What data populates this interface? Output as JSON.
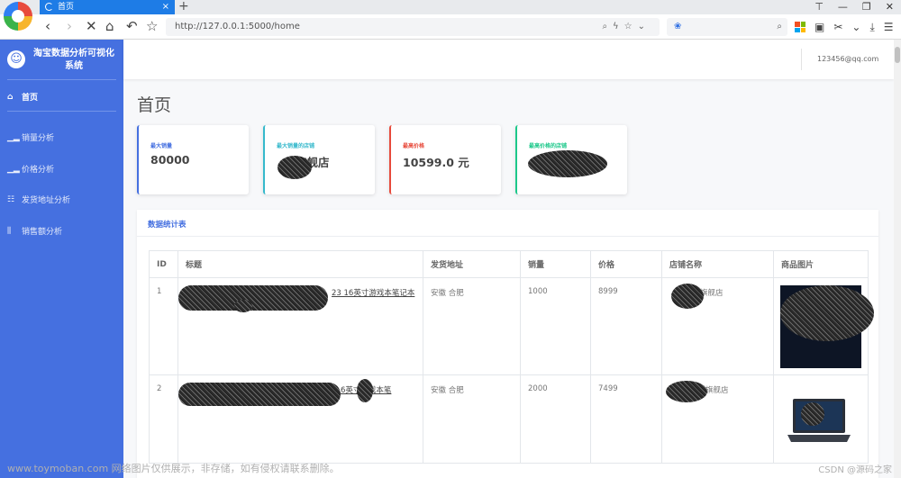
{
  "browser": {
    "tab_title": "首页",
    "tab_close": "×",
    "new_tab": "+",
    "url": "http://127.0.0.1:5000/home",
    "window_controls": [
      "⊤",
      "—",
      "❐",
      "✕"
    ]
  },
  "sidebar": {
    "brand": "淘宝数据分析可视化系统",
    "items": [
      {
        "label": "首页",
        "icon": "home-icon"
      },
      {
        "label": "销量分析",
        "icon": "bar-chart-icon"
      },
      {
        "label": "价格分析",
        "icon": "bar-chart-icon"
      },
      {
        "label": "发货地址分析",
        "icon": "list-icon"
      },
      {
        "label": "销售额分析",
        "icon": "columns-icon"
      }
    ]
  },
  "header": {
    "user_email": "123456@qq.com"
  },
  "page": {
    "title": "首页"
  },
  "stats": [
    {
      "label": "最大销量",
      "value": "80000",
      "color": "#4570e0"
    },
    {
      "label": "最大销量的店铺",
      "value": "旗舰店",
      "color": "#36b9cc"
    },
    {
      "label": "最高价格",
      "value": "10599.0 元",
      "color": "#e74a3b"
    },
    {
      "label": "最高价格的店铺",
      "value": "",
      "color": "#1cc88a"
    }
  ],
  "table": {
    "title": "数据统计表",
    "columns": [
      "ID",
      "标题",
      "发货地址",
      "销量",
      "价格",
      "店铺名称",
      "商品图片"
    ],
    "rows": [
      {
        "id": "1",
        "title": "23 16英寸游戏本笔记本",
        "address": "安徽 合肥",
        "sales": "1000",
        "price": "8999",
        "shop": "旗舰店"
      },
      {
        "id": "2",
        "title": "6英寸游戏本笔",
        "address": "安徽 合肥",
        "sales": "2000",
        "price": "7499",
        "shop": "旗舰店"
      }
    ]
  },
  "watermark": "www.toymoban.com 网络图片仅供展示，非存储，如有侵权请联系删除。",
  "csdn_mark": "CSDN @源码之家"
}
